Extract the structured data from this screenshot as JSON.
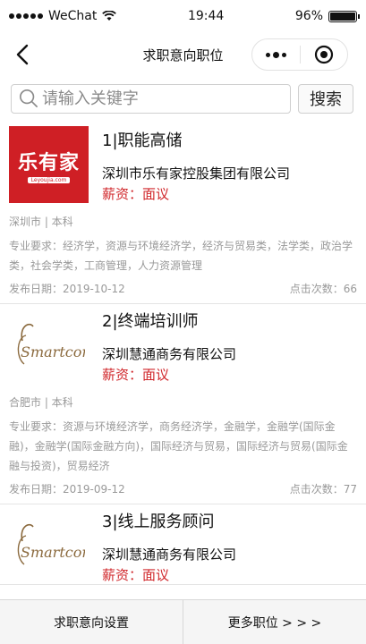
{
  "status_bar": {
    "carrier": "WeChat",
    "time": "19:44",
    "battery": "96%"
  },
  "nav": {
    "title": "求职意向职位"
  },
  "search": {
    "placeholder": "请输入关键字",
    "button": "搜索"
  },
  "jobs": [
    {
      "title": "1|职能高储",
      "company": "深圳市乐有家控股集团有限公司",
      "salary": "薪资：面议",
      "location_edu": "深圳市 | 本科",
      "requirement": "专业要求：经济学，资源与环境经济学，经济与贸易类，法学类，政治学类，社会学类，工商管理，人力资源管理",
      "publish_date": "发布日期：2019-10-12",
      "clicks": "点击次数：66",
      "logo": {
        "type": "leyoujia",
        "text": "乐有家",
        "sub": "Leyoujia.com"
      }
    },
    {
      "title": "2|终端培训师",
      "company": "深圳慧通商务有限公司",
      "salary": "薪资：面议",
      "location_edu": "合肥市 | 本科",
      "requirement": "专业要求：资源与环境经济学，商务经济学，金融学，金融学(国际金融)，金融学(国际金融方向)，国际经济与贸易，国际经济与贸易(国际金融与投资)，贸易经济",
      "publish_date": "发布日期：2019-09-12",
      "clicks": "点击次数：77",
      "logo": {
        "type": "smartcom",
        "text": "Smartcom"
      }
    },
    {
      "title": "3|线上服务顾问",
      "company": "深圳慧通商务有限公司",
      "salary": "薪资：面议",
      "logo": {
        "type": "smartcom",
        "text": "Smartcom"
      }
    }
  ],
  "bottom": {
    "left": "求职意向设置",
    "right": "更多职位 > > >"
  },
  "colors": {
    "salary": "#d0272b",
    "leyoujia_red": "#cf1f25",
    "smartcom_brown": "#8b6a3e"
  }
}
